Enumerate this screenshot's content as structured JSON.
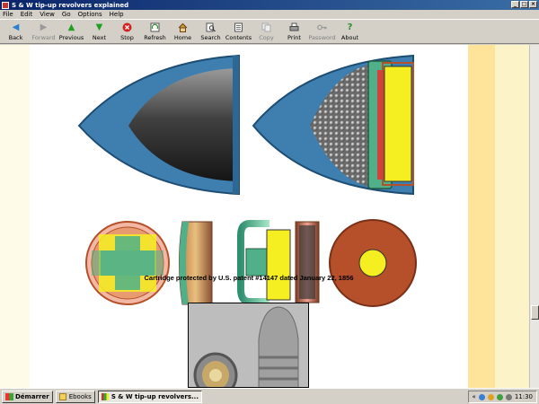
{
  "window": {
    "title": "S & W tip-up revolvers explained"
  },
  "menu": [
    "File",
    "Edit",
    "View",
    "Go",
    "Options",
    "Help"
  ],
  "toolbar": [
    {
      "label": "Back",
      "icon": "back-arrow-icon",
      "enabled": true
    },
    {
      "label": "Forward",
      "icon": "forward-arrow-icon",
      "enabled": false
    },
    {
      "label": "Previous",
      "icon": "up-arrow-icon",
      "enabled": true
    },
    {
      "label": "Next",
      "icon": "down-arrow-icon",
      "enabled": true
    },
    {
      "label": "Stop",
      "icon": "stop-icon",
      "enabled": true
    },
    {
      "label": "Refresh",
      "icon": "refresh-icon",
      "enabled": true
    },
    {
      "label": "Home",
      "icon": "home-icon",
      "enabled": true
    },
    {
      "label": "Search",
      "icon": "search-icon",
      "enabled": true
    },
    {
      "label": "Contents",
      "icon": "contents-icon",
      "enabled": true
    },
    {
      "label": "Copy",
      "icon": "copy-icon",
      "enabled": false
    },
    {
      "label": "Print",
      "icon": "print-icon",
      "enabled": true
    },
    {
      "label": "Password",
      "icon": "key-icon",
      "enabled": false
    },
    {
      "label": "About",
      "icon": "about-icon",
      "enabled": true
    }
  ],
  "content": {
    "caption": "Cartridge protected by U.S. patent #14147 dated January 22, 1856"
  },
  "taskbar": {
    "start_label": "Démarrer",
    "tasks": [
      {
        "label": "Ebooks",
        "active": false
      },
      {
        "label": "S & W tip-up revolvers...",
        "active": true
      }
    ],
    "clock": "11:30"
  },
  "colors": {
    "cartridge_blue": "#3f7fb0",
    "bullet_grey": "#555555",
    "copper": "#b5502a",
    "primer_yellow": "#f5ef22",
    "teal": "#4fb089"
  }
}
